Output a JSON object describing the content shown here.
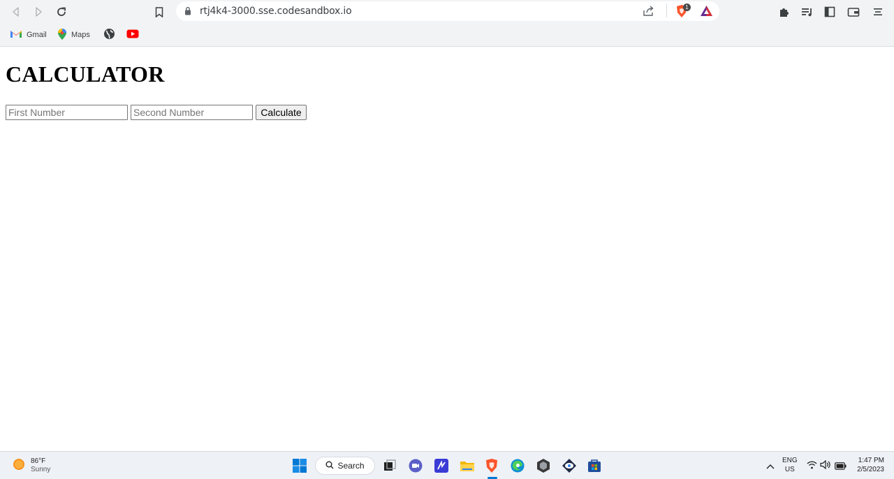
{
  "browser": {
    "url": "rtj4k4-3000.sse.codesandbox.io",
    "brave_badge_count": "1",
    "bookmarks": [
      {
        "label": "Gmail",
        "icon": "gmail-icon"
      },
      {
        "label": "Maps",
        "icon": "maps-icon"
      },
      {
        "label": "",
        "icon": "globe-icon"
      },
      {
        "label": "",
        "icon": "youtube-icon"
      }
    ]
  },
  "page": {
    "title": "CALCULATOR",
    "first_placeholder": "First Number",
    "second_placeholder": "Second Number",
    "calculate_label": "Calculate"
  },
  "taskbar": {
    "weather_temp": "86°F",
    "weather_desc": "Sunny",
    "search_label": "Search",
    "lang_top": "ENG",
    "lang_bottom": "US",
    "time": "1:47 PM",
    "date": "2/5/2023"
  },
  "colors": {
    "chrome_bg": "#f1f3f4",
    "brave_orange": "#fb542b",
    "youtube_red": "#ff0000",
    "windows_blue": "#0078d4"
  }
}
